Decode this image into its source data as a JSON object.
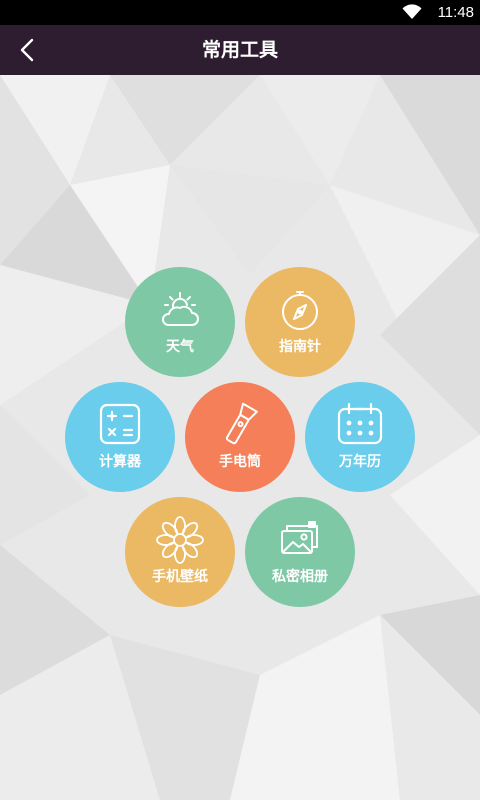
{
  "status_bar": {
    "time": "11:48"
  },
  "app_bar": {
    "title": "常用工具"
  },
  "colors": {
    "app_bar": "#2e1d30",
    "green": "#7ec8a6",
    "yellow": "#ebb863",
    "blue": "#69cdeb",
    "orange": "#f47f58"
  },
  "tools": {
    "weather": {
      "label": "天气",
      "icon": "weather-icon"
    },
    "compass": {
      "label": "指南针",
      "icon": "compass-icon"
    },
    "calculator": {
      "label": "计算器",
      "icon": "calculator-icon"
    },
    "flashlight": {
      "label": "手电筒",
      "icon": "flashlight-icon"
    },
    "calendar": {
      "label": "万年历",
      "icon": "calendar-icon"
    },
    "wallpaper": {
      "label": "手机壁纸",
      "icon": "flower-icon"
    },
    "album": {
      "label": "私密相册",
      "icon": "photo-icon"
    }
  }
}
